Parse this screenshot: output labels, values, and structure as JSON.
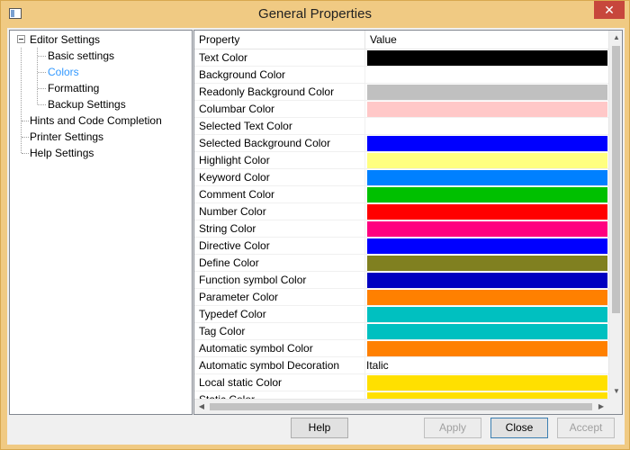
{
  "window": {
    "title": "General Properties",
    "close_glyph": "✕",
    "app_icon": "window-app-icon"
  },
  "tree": {
    "items": [
      {
        "label": "Editor Settings",
        "level": 0,
        "expanded": true
      },
      {
        "label": "Basic settings",
        "level": 1
      },
      {
        "label": "Colors",
        "level": 1,
        "selected": true
      },
      {
        "label": "Formatting",
        "level": 1
      },
      {
        "label": "Backup Settings",
        "level": 1
      },
      {
        "label": "Hints and Code Completion",
        "level": 0
      },
      {
        "label": "Printer Settings",
        "level": 0
      },
      {
        "label": "Help Settings",
        "level": 0
      }
    ]
  },
  "grid": {
    "header_property": "Property",
    "header_value": "Value",
    "rows": [
      {
        "name": "Text Color",
        "color": "#000000"
      },
      {
        "name": "Background Color",
        "color": "#ffffff"
      },
      {
        "name": "Readonly Background Color",
        "color": "#c0c0c0"
      },
      {
        "name": "Columbar Color",
        "color": "#ffc8c8"
      },
      {
        "name": "Selected Text Color",
        "color": "#ffffff"
      },
      {
        "name": "Selected Background Color",
        "color": "#0000ff"
      },
      {
        "name": "Highlight Color",
        "color": "#ffff80"
      },
      {
        "name": "Keyword Color",
        "color": "#0080ff"
      },
      {
        "name": "Comment Color",
        "color": "#00c000"
      },
      {
        "name": "Number Color",
        "color": "#ff0000"
      },
      {
        "name": "String Color",
        "color": "#ff0080"
      },
      {
        "name": "Directive Color",
        "color": "#0000ff"
      },
      {
        "name": "Define Color",
        "color": "#808020"
      },
      {
        "name": "Function symbol Color",
        "color": "#0000c0"
      },
      {
        "name": "Parameter Color",
        "color": "#ff8000"
      },
      {
        "name": "Typedef Color",
        "color": "#00c0c0"
      },
      {
        "name": "Tag Color",
        "color": "#00c0c0"
      },
      {
        "name": "Automatic symbol Color",
        "color": "#ff8000"
      },
      {
        "name": "Automatic symbol Decoration",
        "text": "Italic"
      },
      {
        "name": "Local static Color",
        "color": "#ffe000"
      },
      {
        "name": "Static Color",
        "color": "#ffe000"
      }
    ]
  },
  "buttons": {
    "help": "Help",
    "apply": "Apply",
    "close": "Close",
    "accept": "Accept"
  }
}
